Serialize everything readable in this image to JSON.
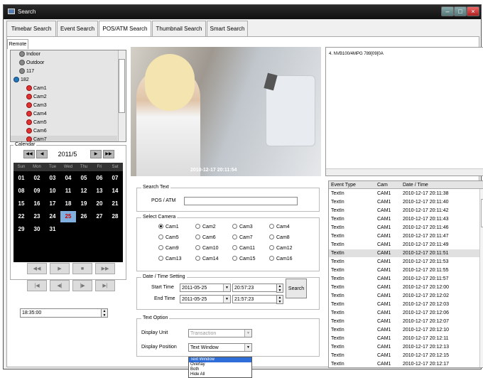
{
  "window": {
    "title": "Search"
  },
  "tabs": [
    "Timebar Search",
    "Event Search",
    "POS/ATM Search",
    "Thumbnail Search",
    "Smart Search"
  ],
  "subtab": "Remote",
  "tree": [
    {
      "label": "Indoor",
      "icon": "gray"
    },
    {
      "label": "Outdoor",
      "icon": "gray"
    },
    {
      "label": "117",
      "icon": "gray"
    },
    {
      "label": "182",
      "icon": "blue"
    },
    {
      "label": "Cam1",
      "icon": "red"
    },
    {
      "label": "Cam2",
      "icon": "red"
    },
    {
      "label": "Cam3",
      "icon": "red"
    },
    {
      "label": "Cam4",
      "icon": "red"
    },
    {
      "label": "Cam5",
      "icon": "red"
    },
    {
      "label": "Cam6",
      "icon": "red"
    },
    {
      "label": "Cam7",
      "icon": "red"
    }
  ],
  "calendar": {
    "label": "Calendar",
    "month": "2011/5",
    "weekdays": [
      "Sun",
      "Mon",
      "Tue",
      "Wed",
      "Thu",
      "Fri",
      "Sat"
    ],
    "weeks": [
      [
        "01",
        "02",
        "03",
        "04",
        "05",
        "06",
        "07"
      ],
      [
        "08",
        "09",
        "10",
        "11",
        "12",
        "13",
        "14"
      ],
      [
        "15",
        "16",
        "17",
        "18",
        "19",
        "20",
        "21"
      ],
      [
        "22",
        "23",
        "24",
        "25",
        "26",
        "27",
        "28"
      ],
      [
        "29",
        "30",
        "31",
        "",
        "",
        "",
        "",
        ""
      ]
    ],
    "today": "25"
  },
  "playback_time": "18:35:00",
  "video": {
    "timestamp": "2010-12-17 20:11:54"
  },
  "text_panel": {
    "content": "4. NVB100/4MPG 789[09[0A"
  },
  "search_text": {
    "label": "Search Text",
    "field_label": "POS / ATM",
    "value": ""
  },
  "select_camera": {
    "label": "Select Camera",
    "cameras": [
      "Cam1",
      "Cam2",
      "Cam3",
      "Cam4",
      "Cam5",
      "Cam6",
      "Cam7",
      "Cam8",
      "Cam9",
      "Cam10",
      "Cam11",
      "Cam12",
      "Cam13",
      "Cam14",
      "Cam15",
      "Cam16"
    ],
    "selected": "Cam1"
  },
  "datetime": {
    "label": "Date / Time Setting",
    "start_label": "Start Time",
    "start_date": "2011-05-25",
    "start_time": "20:57:23",
    "end_label": "End Time",
    "end_date": "2011-05-25",
    "end_time": "21:57:23",
    "search_button": "Search"
  },
  "text_option": {
    "label": "Text Option",
    "unit_label": "Display Unit",
    "unit_value": "Transaction",
    "position_label": "Display Position",
    "position_value": "Text  Window",
    "position_options": [
      "Text  Window",
      "Overlay",
      "Both",
      "Hide All"
    ]
  },
  "events": {
    "headers": [
      "Event Type",
      "Cam",
      "Date / Time"
    ],
    "rows": [
      [
        "TextIn",
        "CAM1",
        "2010-12-17 20:11:38"
      ],
      [
        "TextIn",
        "CAM1",
        "2010-12-17 20:11:40"
      ],
      [
        "TextIn",
        "CAM1",
        "2010-12-17 20:11:42"
      ],
      [
        "TextIn",
        "CAM1",
        "2010-12-17 20:11:43"
      ],
      [
        "TextIn",
        "CAM1",
        "2010-12-17 20:11:46"
      ],
      [
        "TextIn",
        "CAM1",
        "2010-12-17 20:11:47"
      ],
      [
        "TextIn",
        "CAM1",
        "2010-12-17 20:11:49"
      ],
      [
        "TextIn",
        "CAM1",
        "2010-12-17 20:11:51"
      ],
      [
        "TextIn",
        "CAM1",
        "2010-12-17 20:11:53"
      ],
      [
        "TextIn",
        "CAM1",
        "2010-12-17 20:11:55"
      ],
      [
        "TextIn",
        "CAM1",
        "2010-12-17 20:11:57"
      ],
      [
        "TextIn",
        "CAM1",
        "2010-12-17 20:12:00"
      ],
      [
        "TextIn",
        "CAM1",
        "2010-12-17 20:12:02"
      ],
      [
        "TextIn",
        "CAM1",
        "2010-12-17 20:12:03"
      ],
      [
        "TextIn",
        "CAM1",
        "2010-12-17 20:12:06"
      ],
      [
        "TextIn",
        "CAM1",
        "2010-12-17 20:12:07"
      ],
      [
        "TextIn",
        "CAM1",
        "2010-12-17 20:12:10"
      ],
      [
        "TextIn",
        "CAM1",
        "2010-12-17 20:12:11"
      ],
      [
        "TextIn",
        "CAM1",
        "2010-12-17 20:12:13"
      ],
      [
        "TextIn",
        "CAM1",
        "2010-12-17 20:12:15"
      ],
      [
        "TextIn",
        "CAM1",
        "2010-12-17 20:12:17"
      ]
    ],
    "selected_index": 7
  }
}
